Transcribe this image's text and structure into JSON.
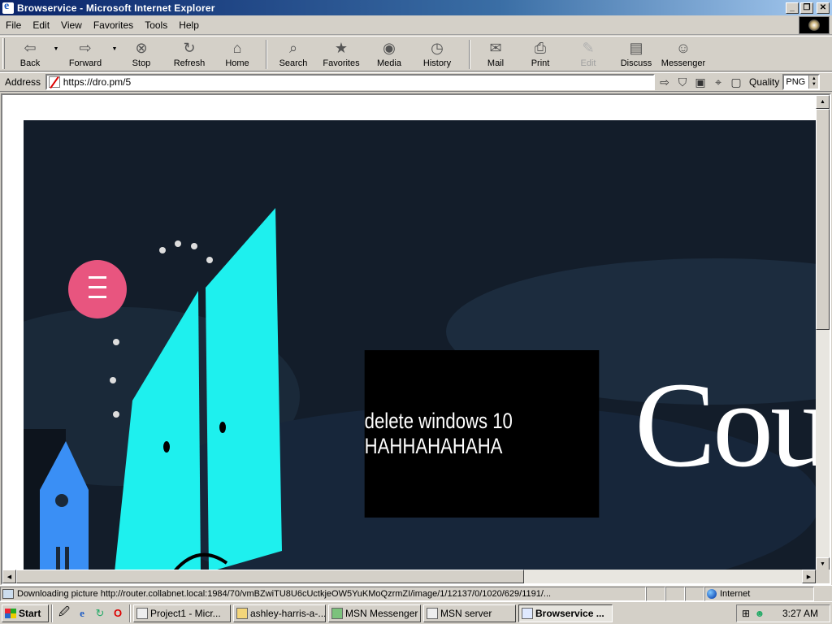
{
  "window": {
    "title": "Browservice - Microsoft Internet Explorer",
    "controls": {
      "minimize": "_",
      "restore": "❐",
      "close": "✕"
    }
  },
  "menu": {
    "items": [
      {
        "label": "File"
      },
      {
        "label": "Edit"
      },
      {
        "label": "View"
      },
      {
        "label": "Favorites"
      },
      {
        "label": "Tools"
      },
      {
        "label": "Help"
      }
    ]
  },
  "toolbar": {
    "back": {
      "label": "Back",
      "icon": "⇦"
    },
    "forward": {
      "label": "Forward",
      "icon": "⇨"
    },
    "stop": {
      "label": "Stop",
      "icon": "⊗"
    },
    "refresh": {
      "label": "Refresh",
      "icon": "↻"
    },
    "home": {
      "label": "Home",
      "icon": "⌂"
    },
    "search": {
      "label": "Search",
      "icon": "⌕"
    },
    "favorites": {
      "label": "Favorites",
      "icon": "★"
    },
    "media": {
      "label": "Media",
      "icon": "◉"
    },
    "history": {
      "label": "History",
      "icon": "◷"
    },
    "mail": {
      "label": "Mail",
      "icon": "✉"
    },
    "print": {
      "label": "Print",
      "icon": "⎙"
    },
    "edit": {
      "label": "Edit",
      "icon": "✎"
    },
    "discuss": {
      "label": "Discuss",
      "icon": "▤"
    },
    "messenger": {
      "label": "Messenger",
      "icon": "☺"
    }
  },
  "address": {
    "label": "Address",
    "url": "https://dro.pm/5",
    "quality_label": "Quality",
    "quality_value": "PNG"
  },
  "page": {
    "overlay_text": "delete windows 10 HAHHAHAHAHA",
    "big_word": "Countd",
    "colors": {
      "background": "#131d2a",
      "cyan": "#1ef0ee",
      "pink": "#e8557f",
      "blue": "#3a8ff5"
    }
  },
  "status": {
    "text": "Downloading picture http://router.collabnet.local:1984/70/vmBZwiTU8U6cUctkjeOW5YuKMoQzrmZI/image/1/12137/0/1020/629/1191/...",
    "zone": "Internet"
  },
  "taskbar": {
    "start": "Start",
    "quicklaunch": [
      "desktop-icon",
      "ie-icon",
      "outlook-icon",
      "opera-icon"
    ],
    "tasks": [
      {
        "label": "Project1 - Micr...",
        "active": false
      },
      {
        "label": "ashley-harris-a-...",
        "active": false
      },
      {
        "label": "MSN Messenger",
        "active": false
      },
      {
        "label": "MSN server",
        "active": false
      },
      {
        "label": "Browservice ...",
        "active": true
      }
    ],
    "clock": "3:27 AM"
  }
}
